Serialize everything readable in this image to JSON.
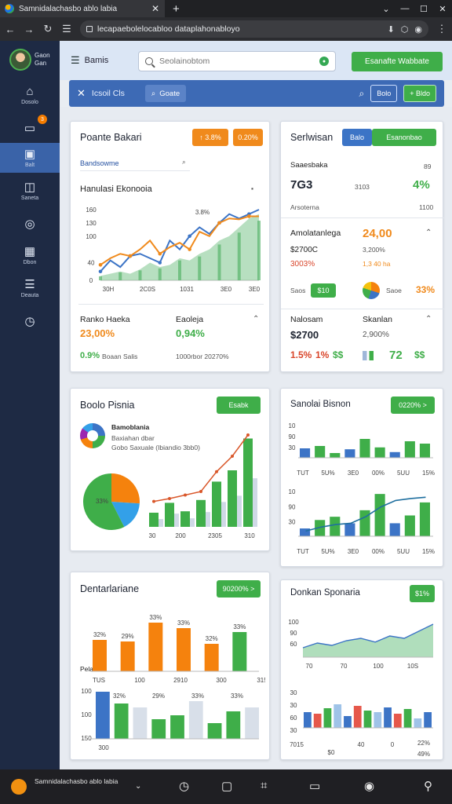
{
  "browser": {
    "tab_title": "Samnidalachasbo ablo labia",
    "url": "lecapaebolelocabloo dataplahonabloyo",
    "icons": [
      "back-icon",
      "forward-icon",
      "reload-icon",
      "lock-icon",
      "download-icon",
      "extensions-icon",
      "profile-icon",
      "menu-dots-icon"
    ]
  },
  "user": {
    "name": "Gaon Gan"
  },
  "nav": [
    {
      "label": "Dosolo",
      "icon": "home-icon",
      "glyph": "⌂"
    },
    {
      "label": "",
      "icon": "monitor-icon",
      "glyph": "▭",
      "badge": "3"
    },
    {
      "label": "Balt",
      "icon": "board-icon",
      "glyph": "▣",
      "active": true
    },
    {
      "label": "Saneta",
      "icon": "document-icon",
      "glyph": "◫"
    },
    {
      "label": "",
      "icon": "compass-icon",
      "glyph": "◎"
    },
    {
      "label": "Dbon",
      "icon": "grid-icon",
      "glyph": "▦"
    },
    {
      "label": "Deauta",
      "icon": "list-icon",
      "glyph": "☰"
    },
    {
      "label": "",
      "icon": "clock-icon",
      "glyph": "◷"
    }
  ],
  "appbar": {
    "title": "Bamis",
    "search_placeholder": "Seolainobtom",
    "primary_button": "Esanafte Wabbate"
  },
  "filterbar": {
    "text": "Icsoil Cls",
    "chip": "Goate",
    "btn1": "Bolo",
    "btn2": "+ Bldo"
  },
  "card1": {
    "title": "Poante Bakari",
    "badge1": "↑ 3.8%",
    "badge2": "0.20%",
    "filter_label": "Bandsowme",
    "subtitle": "Hanulasi Ekonooia",
    "stat1_label": "Ranko Haeka",
    "stat1_value": "23,00%",
    "stat2_label": "Eaoleja",
    "stat2_value": "0,94%",
    "footer_left_value": "0.9%",
    "footer_left_text": "Boaan Salis",
    "footer_right": "1000rbor 20270%"
  },
  "card2": {
    "title": "Serlwisan",
    "tab1": "Balo",
    "tab2": "Esanonbao",
    "row1_label": "Saaesbaka",
    "row1_extra": "89",
    "row1_val": "7G3",
    "row1_mid": "3103",
    "row1_pct": "4%",
    "row1_sub": "Arsoterna",
    "row1_sub_val": "1100",
    "sec2_title": "Amolatanlega",
    "sec2_value": "24,00",
    "sec2_a": "$2700C",
    "sec2_b": "3,200%",
    "sec2_c": "3003%",
    "sec2_d": "1,3 40 ha",
    "sec2_row_label": "Saos",
    "sec2_row_btn": "$10",
    "sec2_row_label2": "Saoe",
    "sec2_row_pct": "33%",
    "sec3_label1": "Nalosam",
    "sec3_label2": "Skanlan",
    "sec3_val1": "$2700",
    "sec3_val2": "2,900%",
    "sec3_a": "1.5%",
    "sec3_b": "1%",
    "sec3_c": "$$",
    "sec3_d": "72",
    "sec3_e": "$$"
  },
  "card3": {
    "title": "Boolo Pisnia",
    "button": "Esabk",
    "legend_title": "Bamoblania",
    "legend_line1": "Baxiahan dbar",
    "legend_line2": "Gobo Saxuale (Ibiandio 3bb0)",
    "pie_label": "33%"
  },
  "card4": {
    "title": "Sanolai Bisnon",
    "button": "0220% >"
  },
  "card5": {
    "title": "Dentarlariane",
    "button": "90200% >",
    "sub_label": "Pelam"
  },
  "card6": {
    "title": "Donkan Sponaria",
    "button": "$1%",
    "footer": [
      "7015",
      "$0",
      "40",
      "0",
      "22%",
      "49%"
    ]
  },
  "chart_data": [
    {
      "type": "line",
      "title": "Hanulasi Ekonooia",
      "x": [
        "30H",
        "2C0S",
        "1031",
        "3E0",
        "3E0"
      ],
      "ylim": [
        0,
        160
      ],
      "yticks": [
        0,
        40,
        100,
        130,
        160
      ],
      "series": [
        {
          "name": "blue",
          "values": [
            20,
            45,
            30,
            55,
            60,
            50,
            40,
            90,
            70,
            100,
            120,
            105,
            130,
            150,
            140,
            150,
            160
          ]
        },
        {
          "name": "orange",
          "values": [
            35,
            50,
            60,
            55,
            70,
            90,
            60,
            75,
            85,
            70,
            110,
            100,
            130,
            140,
            138,
            145,
            145
          ]
        },
        {
          "name": "area",
          "values": [
            10,
            15,
            20,
            15,
            25,
            40,
            30,
            35,
            50,
            45,
            60,
            70,
            90,
            100,
            120,
            140,
            150
          ]
        }
      ],
      "annotations": [
        "3.8%"
      ]
    },
    {
      "type": "bar",
      "title": "Boolo Pisnia",
      "categories": [
        "30",
        "200",
        "2305",
        "310"
      ],
      "series": [
        {
          "name": "bars",
          "values": [
            20,
            34,
            22,
            38,
            64,
            80,
            125
          ]
        },
        {
          "name": "line",
          "values": [
            36,
            40,
            45,
            50,
            78,
            100,
            130
          ]
        }
      ],
      "pie": [
        {
          "label": "33%",
          "value": 52,
          "color": "#f5820d"
        },
        {
          "label": "",
          "value": 33,
          "color": "#33a0e8"
        },
        {
          "label": "",
          "value": 115,
          "color": "#3fae49"
        }
      ]
    },
    {
      "type": "bar",
      "title": "Sanolai Bisnon",
      "categories": [
        "TUT",
        "5U%",
        "3E0",
        "00%",
        "5UU",
        "15%"
      ],
      "series": [
        {
          "name": "top",
          "values": [
            20,
            25,
            10,
            18,
            40,
            22,
            12,
            35,
            30
          ]
        },
        {
          "name": "bottom",
          "values": [
            12,
            25,
            30,
            20,
            40,
            65,
            20,
            32,
            52
          ]
        }
      ]
    },
    {
      "type": "bar",
      "title": "Dentarlariane",
      "categories": [
        "TUS",
        "100",
        "2910",
        "300",
        "315"
      ],
      "series": [
        {
          "name": "orange",
          "values": [
            40,
            38,
            62,
            55,
            35,
            50
          ]
        },
        {
          "name": "green-blue",
          "values": [
            60,
            45,
            40,
            25,
            30,
            48,
            20,
            35,
            40
          ]
        }
      ]
    },
    {
      "type": "area",
      "title": "Donkan Sponaria",
      "yticks": [
        60,
        90,
        100
      ],
      "series": [
        {
          "name": "line",
          "values": [
            20,
            30,
            25,
            35,
            40,
            32,
            45,
            40,
            55,
            70
          ]
        },
        {
          "name": "bars",
          "values": [
            20,
            18,
            25,
            30,
            15,
            28,
            22,
            20,
            26,
            18,
            24,
            12,
            20
          ]
        }
      ]
    }
  ]
}
